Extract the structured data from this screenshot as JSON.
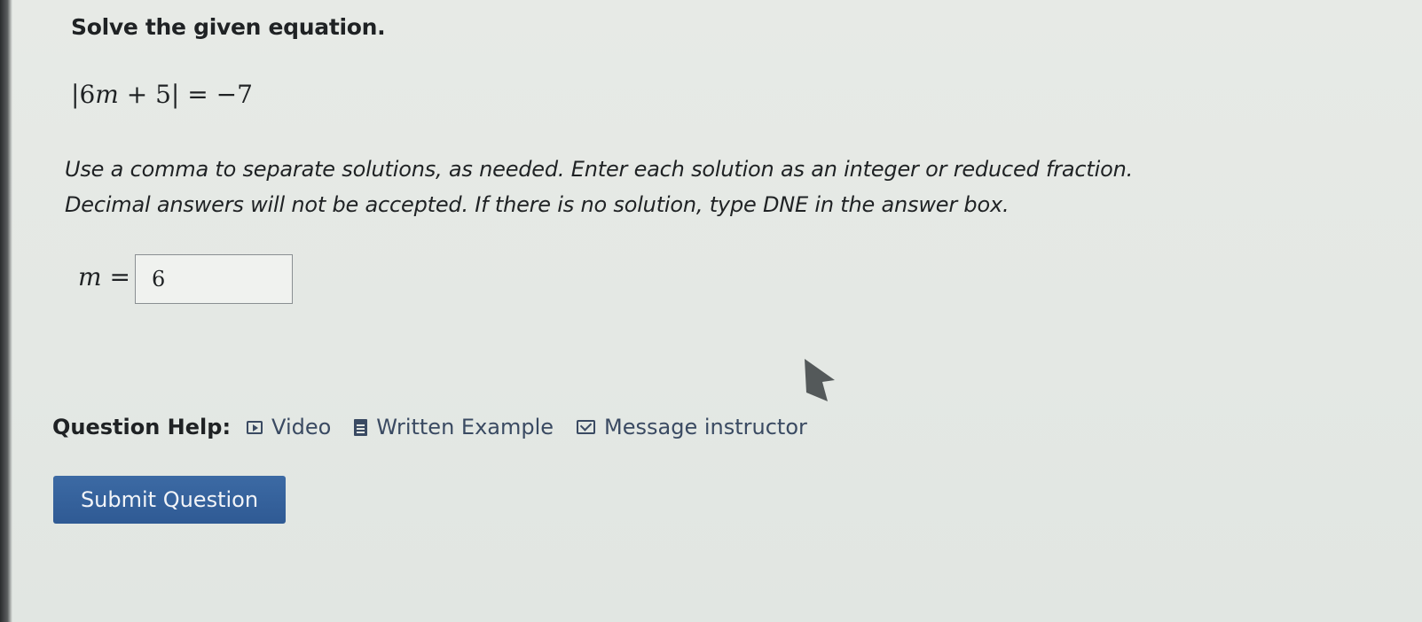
{
  "question": {
    "prompt": "Solve the given equation.",
    "equation": {
      "open_bar": "|",
      "coef": "6",
      "variable": "m",
      "plus_const": " + 5",
      "close_bar": "|",
      "rhs": " = −7"
    },
    "instructions": [
      "Use a comma to separate solutions, as needed.  Enter each solution as an integer or reduced fraction.",
      "Decimal answers will not be accepted.  If there is no solution, type DNE in the answer box."
    ]
  },
  "answer": {
    "variable": "m",
    "equals": " =",
    "value": "6"
  },
  "help": {
    "label": "Question Help:",
    "links": [
      {
        "icon": "video-icon",
        "label": "Video"
      },
      {
        "icon": "document-icon",
        "label": "Written Example"
      },
      {
        "icon": "mail-icon",
        "label": "Message instructor"
      }
    ]
  },
  "actions": {
    "submit_label": "Submit Question"
  },
  "colors": {
    "link": "#3a4a62",
    "submit_bg": "#3463a0",
    "background": "#e4e8e4"
  }
}
